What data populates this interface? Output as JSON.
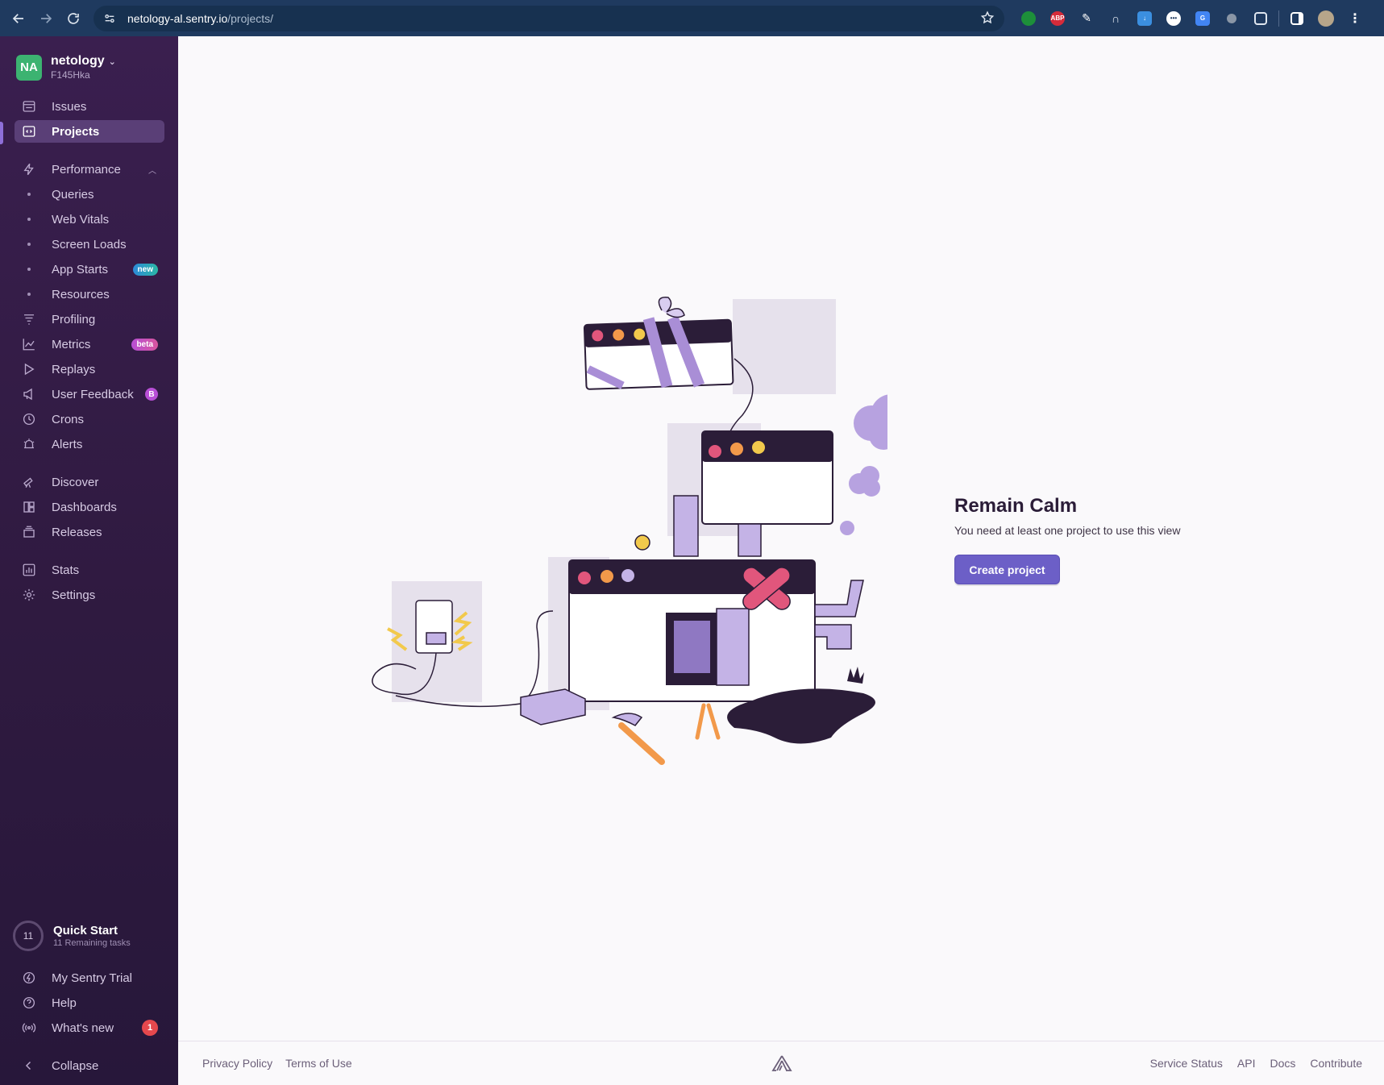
{
  "browser": {
    "url_host": "netology-al.sentry.io",
    "url_path": "/projects/",
    "extensions": [
      "green-circle-extension",
      "adblock-plus-extension",
      "eyedropper-extension",
      "headphones-extension",
      "download-extension",
      "password-extension",
      "translate-extension",
      "gray-circle-extension",
      "puzzle-extension"
    ],
    "abp_label": "ABP"
  },
  "org": {
    "avatar": "NA",
    "name": "netology",
    "subtitle": "F145Hka"
  },
  "sidebar": {
    "items": [
      {
        "label": "Issues",
        "icon": "issues-icon"
      },
      {
        "label": "Projects",
        "icon": "projects-icon",
        "active": true
      },
      {
        "label": "Performance",
        "icon": "performance-icon",
        "expanded": true
      },
      {
        "label": "Queries"
      },
      {
        "label": "Web Vitals"
      },
      {
        "label": "Screen Loads"
      },
      {
        "label": "App Starts",
        "badge": "new"
      },
      {
        "label": "Resources"
      },
      {
        "label": "Profiling",
        "icon": "profiling-icon"
      },
      {
        "label": "Metrics",
        "icon": "metrics-icon",
        "badge": "beta"
      },
      {
        "label": "Replays",
        "icon": "replays-icon"
      },
      {
        "label": "User Feedback",
        "icon": "user-feedback-icon",
        "badge": "B"
      },
      {
        "label": "Crons",
        "icon": "crons-icon"
      },
      {
        "label": "Alerts",
        "icon": "alerts-icon"
      },
      {
        "label": "Discover",
        "icon": "discover-icon"
      },
      {
        "label": "Dashboards",
        "icon": "dashboards-icon"
      },
      {
        "label": "Releases",
        "icon": "releases-icon"
      },
      {
        "label": "Stats",
        "icon": "stats-icon"
      },
      {
        "label": "Settings",
        "icon": "settings-icon"
      }
    ],
    "quickstart": {
      "count": "11",
      "title": "Quick Start",
      "subtitle": "11 Remaining tasks"
    },
    "bottom": [
      {
        "label": "My Sentry Trial",
        "icon": "trial-icon"
      },
      {
        "label": "Help",
        "icon": "help-icon"
      },
      {
        "label": "What's new",
        "icon": "broadcast-icon",
        "badge": "1"
      },
      {
        "label": "Collapse",
        "icon": "chevron-left-icon"
      }
    ]
  },
  "main": {
    "title": "Remain Calm",
    "description": "You need at least one project to use this view",
    "button": "Create project"
  },
  "footer": {
    "left": [
      "Privacy Policy",
      "Terms of Use"
    ],
    "right": [
      "Service Status",
      "API",
      "Docs",
      "Contribute"
    ]
  },
  "colors": {
    "accent": "#6c5fc7",
    "sidebar": "#3a1f4f",
    "chrome": "#1f3a5f"
  }
}
